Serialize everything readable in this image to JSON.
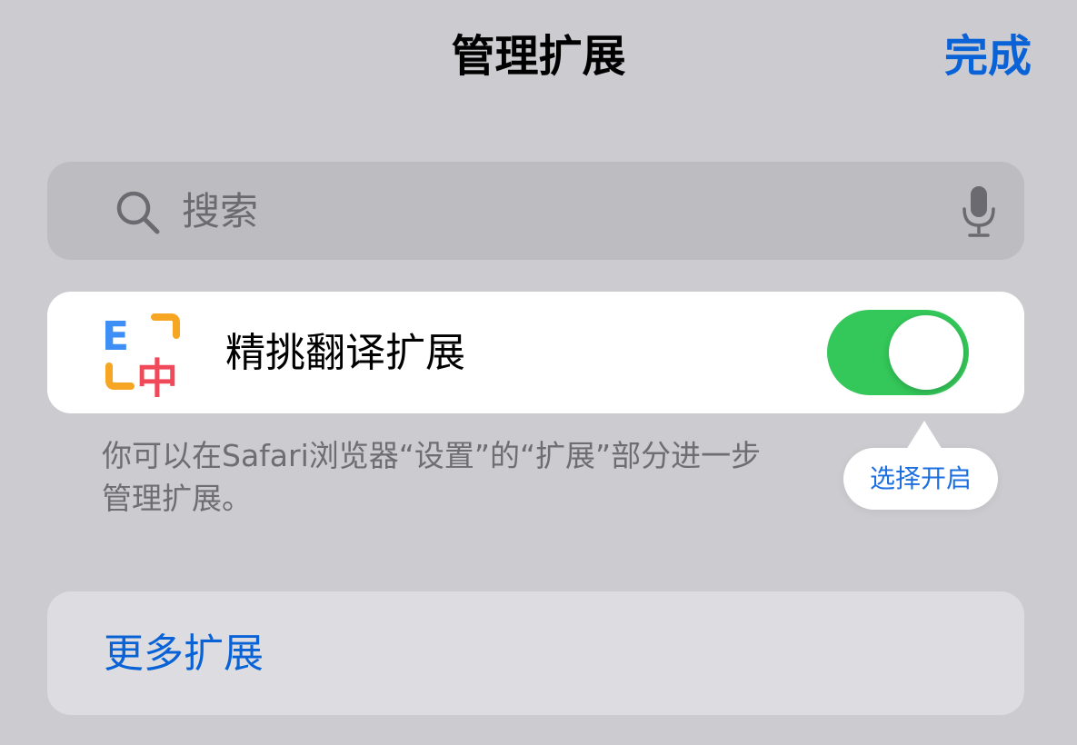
{
  "header": {
    "title": "管理扩展",
    "done_label": "完成"
  },
  "search": {
    "placeholder": "搜索",
    "value": ""
  },
  "extension": {
    "name": "精挑翻译扩展",
    "enabled": true,
    "logo_letter_top": "E",
    "logo_letter_bottom": "中"
  },
  "footnote": {
    "line1": "你可以在Safari浏览器“设置”的“扩展”部分进一步",
    "line2": "管理扩展。"
  },
  "tooltip": {
    "label": "选择开启"
  },
  "more": {
    "label": "更多扩展"
  },
  "colors": {
    "accent": "#0a63d6",
    "toggle_on": "#34c759",
    "logo_blue": "#3d8ef5",
    "logo_orange": "#f6a623",
    "logo_red": "#f04a5a"
  }
}
